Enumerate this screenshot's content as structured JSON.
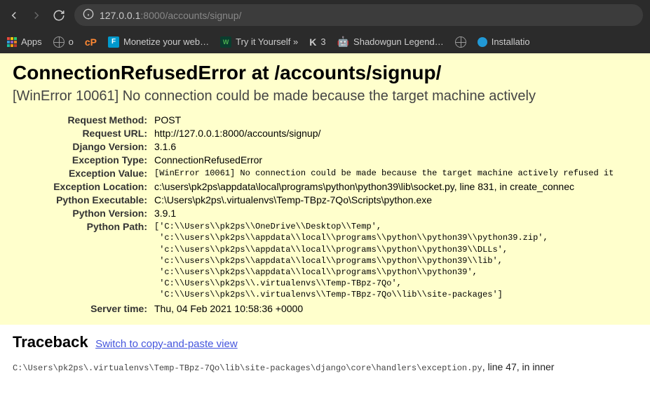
{
  "browser": {
    "url_host": "127.0.0.1",
    "url_port": ":8000",
    "url_path": "/accounts/signup/",
    "bookmarks": {
      "apps": "Apps",
      "o": "o",
      "monetize": "Monetize your web…",
      "tryit": "Try it Yourself »",
      "three": "3",
      "shadowgun": "Shadowgun Legend…",
      "installatio": "Installatio"
    }
  },
  "error": {
    "title": "ConnectionRefusedError at /accounts/signup/",
    "subtitle": "[WinError 10061] No connection could be made because the target machine actively",
    "rows": {
      "request_method_label": "Request Method:",
      "request_method": "POST",
      "request_url_label": "Request URL:",
      "request_url": "http://127.0.0.1:8000/accounts/signup/",
      "django_version_label": "Django Version:",
      "django_version": "3.1.6",
      "exception_type_label": "Exception Type:",
      "exception_type": "ConnectionRefusedError",
      "exception_value_label": "Exception Value:",
      "exception_value": "[WinError 10061] No connection could be made because the target machine actively refused it",
      "exception_location_label": "Exception Location:",
      "exception_location": "c:\\users\\pk2ps\\appdata\\local\\programs\\python\\python39\\lib\\socket.py, line 831, in create_connec",
      "python_executable_label": "Python Executable:",
      "python_executable": "C:\\Users\\pk2ps\\.virtualenvs\\Temp-TBpz-7Qo\\Scripts\\python.exe",
      "python_version_label": "Python Version:",
      "python_version": "3.9.1",
      "python_path_label": "Python Path:",
      "python_path": "['C:\\\\Users\\\\pk2ps\\\\OneDrive\\\\Desktop\\\\Temp',\n 'c:\\\\users\\\\pk2ps\\\\appdata\\\\local\\\\programs\\\\python\\\\python39\\\\python39.zip',\n 'c:\\\\users\\\\pk2ps\\\\appdata\\\\local\\\\programs\\\\python\\\\python39\\\\DLLs',\n 'c:\\\\users\\\\pk2ps\\\\appdata\\\\local\\\\programs\\\\python\\\\python39\\\\lib',\n 'c:\\\\users\\\\pk2ps\\\\appdata\\\\local\\\\programs\\\\python\\\\python39',\n 'C:\\\\Users\\\\pk2ps\\\\.virtualenvs\\\\Temp-TBpz-7Qo',\n 'C:\\\\Users\\\\pk2ps\\\\.virtualenvs\\\\Temp-TBpz-7Qo\\\\lib\\\\site-packages']",
      "server_time_label": "Server time:",
      "server_time": "Thu, 04 Feb 2021 10:58:36 +0000"
    }
  },
  "traceback": {
    "header": "Traceback",
    "switch_link": "Switch to copy-and-paste view",
    "frame_path": "C:\\Users\\pk2ps\\.virtualenvs\\Temp-TBpz-7Qo\\lib\\site-packages\\django\\core\\handlers\\exception.py",
    "frame_suffix": ", line 47, in inner"
  }
}
